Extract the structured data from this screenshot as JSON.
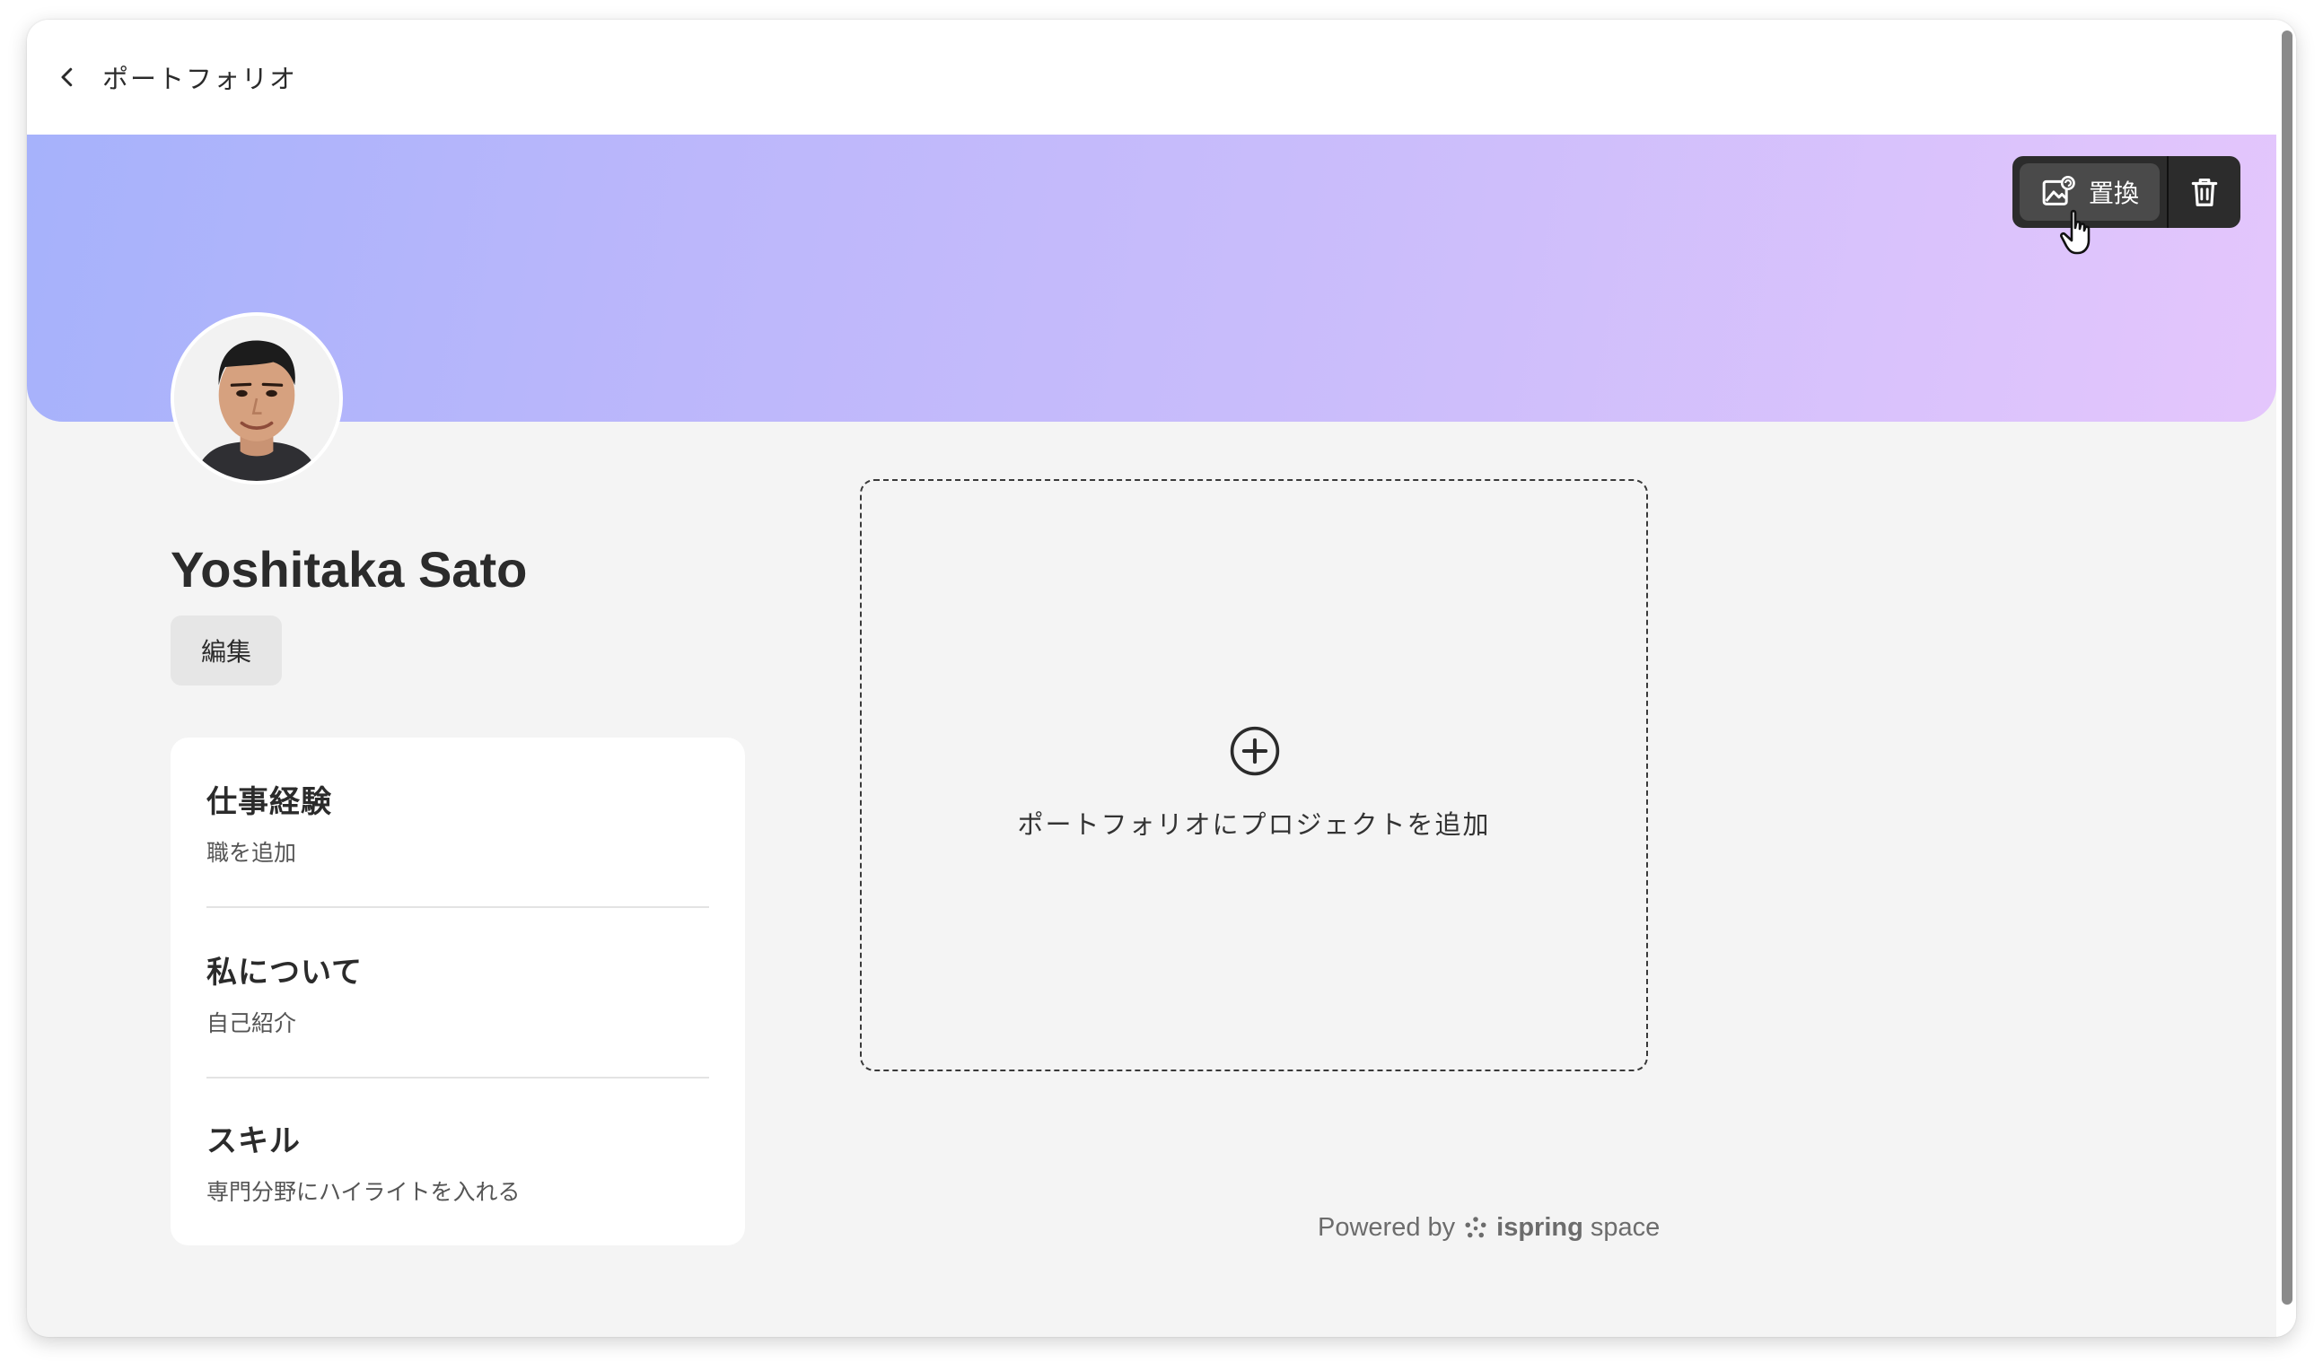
{
  "topbar": {
    "back_label": "ポートフォリオ"
  },
  "cover": {
    "replace_label": "置換",
    "gradient_colors": [
      "#a6b2fb",
      "#cbbdfb",
      "#e4c6fc"
    ]
  },
  "profile": {
    "name": "Yoshitaka Sato",
    "edit_label": "編集"
  },
  "info_card": {
    "sections": [
      {
        "title": "仕事経験",
        "link": "職を追加"
      },
      {
        "title": "私について",
        "link": "自己紹介"
      },
      {
        "title": "スキル",
        "link": "専門分野にハイライトを入れる"
      }
    ]
  },
  "projects": {
    "add_label": "ポートフォリオにプロジェクトを追加"
  },
  "footer": {
    "powered_by": "Powered by",
    "brand_bold": "ispring",
    "brand_light": "space"
  },
  "icons": {
    "back": "chevron-left-icon",
    "replace": "image-replace-icon",
    "delete": "trash-icon",
    "add": "plus-circle-icon",
    "brand": "ispring-logo-icon"
  }
}
